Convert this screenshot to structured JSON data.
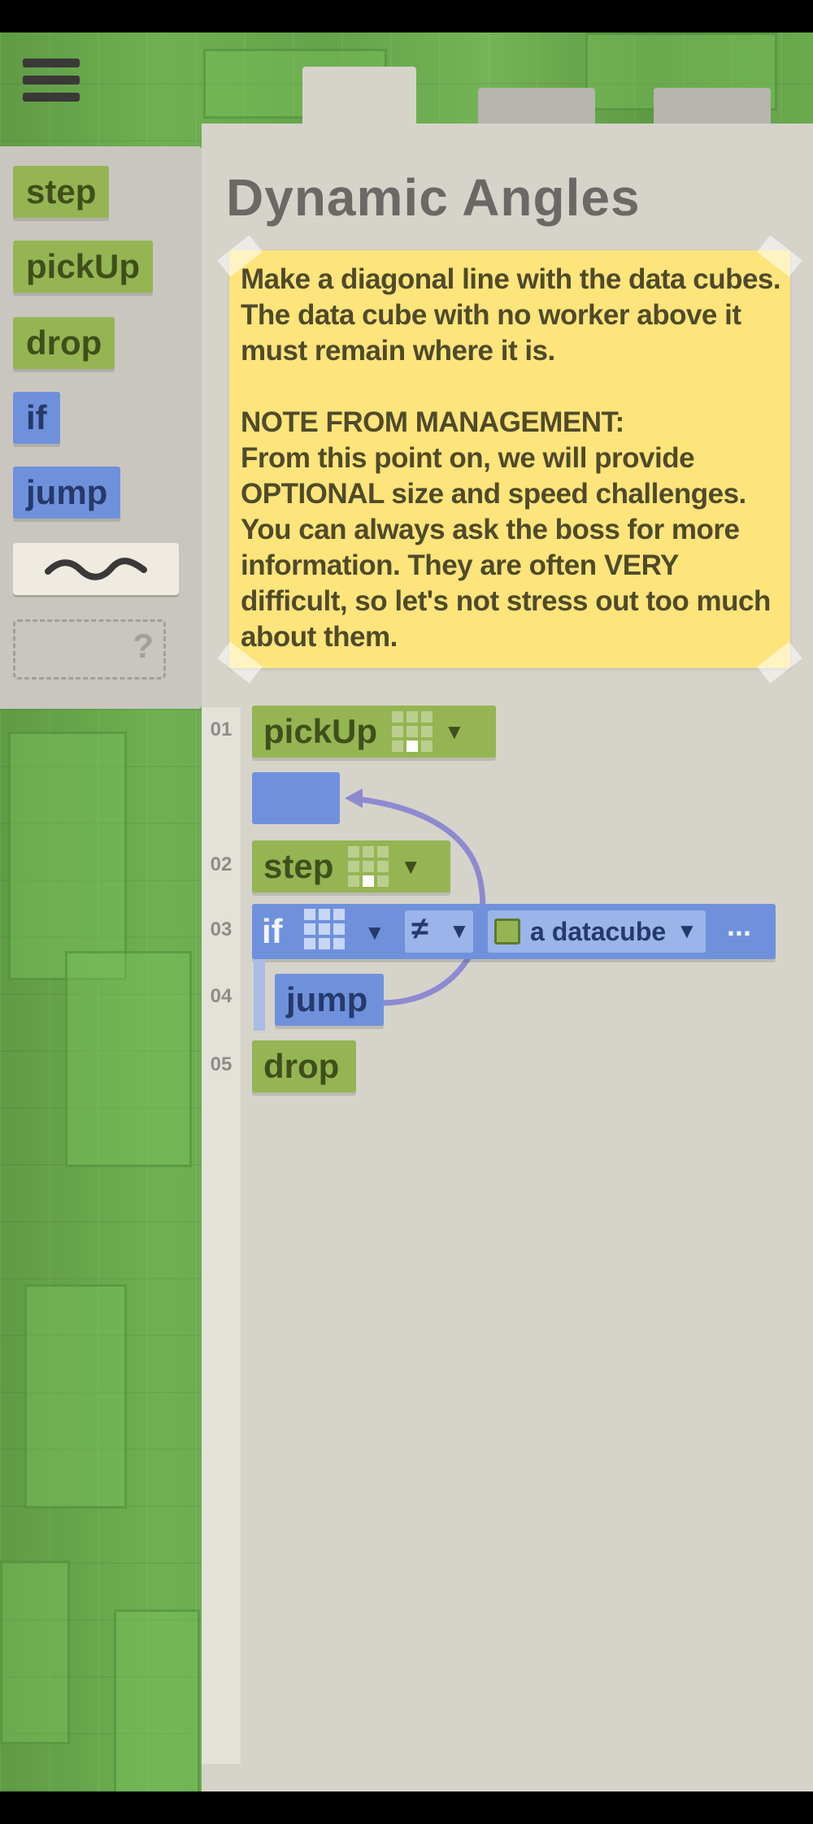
{
  "level": {
    "title": "Dynamic Angles",
    "note_paragraph_1": "Make a diagonal line with the data cubes. The data cube with no worker above it must remain where it is.",
    "note_paragraph_2_heading": "NOTE FROM MANAGEMENT:",
    "note_paragraph_2_body": "From this point on, we will provide OPTIONAL size and speed challenges. You can always ask the boss for more information. They are often VERY difficult, so let's not stress out too much about them."
  },
  "toolbox": {
    "items": [
      "step",
      "pickUp",
      "drop",
      "if",
      "jump"
    ],
    "unknown_label": "?"
  },
  "program": {
    "line_numbers": [
      "01",
      "02",
      "03",
      "04",
      "05"
    ],
    "line1": "pickUp",
    "line2": "step",
    "line3_keyword": "if",
    "line3_operator": "≠",
    "line3_value": "a datacube",
    "line3_more": "...",
    "line4": "jump",
    "line5": "drop"
  },
  "icons": {
    "menu": "hamburger-menu-icon",
    "comment": "squiggle-comment-icon",
    "dropdown": "caret-down-icon",
    "datacube": "datacube-icon"
  },
  "colors": {
    "command_block": "#95b553",
    "flow_block": "#6f91dc",
    "note": "#fde47b",
    "jump_arrow": "#8e8ad0"
  }
}
